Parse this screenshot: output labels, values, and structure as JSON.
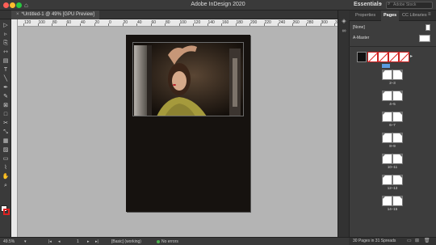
{
  "window": {
    "title": "Adobe InDesign 2020",
    "workspace": "Essentials",
    "search_placeholder": "Adobe Stock"
  },
  "document_tab": {
    "label": "*Untitled-1 @ 49% [GPU Preview]",
    "close_glyph": "×"
  },
  "ruler": {
    "top_labels": [
      "120",
      "100",
      "80",
      "60",
      "40",
      "20",
      "0",
      "20",
      "40",
      "60",
      "80",
      "100",
      "120",
      "140",
      "160",
      "180",
      "200",
      "220",
      "240",
      "260",
      "280",
      "300",
      "320"
    ]
  },
  "tools": [
    {
      "name": "selection-tool",
      "glyph": "▷"
    },
    {
      "name": "direct-selection-tool",
      "glyph": "▹"
    },
    {
      "name": "page-tool",
      "glyph": "⎘"
    },
    {
      "name": "gap-tool",
      "glyph": "⇿"
    },
    {
      "name": "content-collector-tool",
      "glyph": "▤"
    },
    {
      "name": "type-tool",
      "glyph": "T"
    },
    {
      "name": "line-tool",
      "glyph": "╲"
    },
    {
      "name": "pen-tool",
      "glyph": "✒"
    },
    {
      "name": "pencil-tool",
      "glyph": "✎"
    },
    {
      "name": "rectangle-frame-tool",
      "glyph": "⊠"
    },
    {
      "name": "rectangle-tool",
      "glyph": "□"
    },
    {
      "name": "scissors-tool",
      "glyph": "✂"
    },
    {
      "name": "free-transform-tool",
      "glyph": "⤡"
    },
    {
      "name": "gradient-swatch-tool",
      "glyph": "▦"
    },
    {
      "name": "gradient-feather-tool",
      "glyph": "▨"
    },
    {
      "name": "note-tool",
      "glyph": "▭"
    },
    {
      "name": "eyedropper-tool",
      "glyph": "⌇"
    },
    {
      "name": "hand-tool",
      "glyph": "✋"
    },
    {
      "name": "zoom-tool",
      "glyph": "⌕"
    }
  ],
  "status": {
    "zoom": "49.5%",
    "page": "1",
    "profile": "[Basic] (working)",
    "preflight": "No errors"
  },
  "panel": {
    "tabs": [
      "Properties",
      "Pages",
      "CC Libraries"
    ],
    "active_tab": "Pages",
    "masters": [
      "[None]",
      "A-Master"
    ],
    "spread_labels": [
      "2–3",
      "4–5",
      "6–7",
      "8–9",
      "10–11",
      "12–13",
      "14–15"
    ],
    "footer": "30 Pages in 31 Spreads"
  },
  "colors": {
    "accent": "#5a9be0",
    "preflight_ok": "#4caf50",
    "stroke_swatch": "#d22222"
  }
}
